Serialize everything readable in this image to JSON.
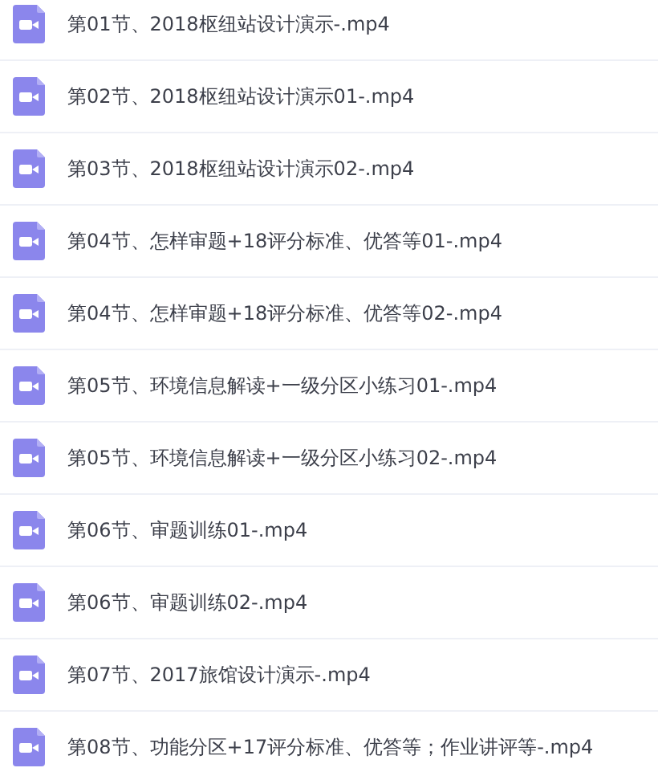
{
  "files": [
    {
      "name": "第01节、2018枢纽站设计演示-.mp4"
    },
    {
      "name": "第02节、2018枢纽站设计演示01-.mp4"
    },
    {
      "name": "第03节、2018枢纽站设计演示02-.mp4"
    },
    {
      "name": "第04节、怎样审题+18评分标准、优答等01-.mp4"
    },
    {
      "name": "第04节、怎样审题+18评分标准、优答等02-.mp4"
    },
    {
      "name": "第05节、环境信息解读+一级分区小练习01-.mp4"
    },
    {
      "name": "第05节、环境信息解读+一级分区小练习02-.mp4"
    },
    {
      "name": "第06节、审题训练01-.mp4"
    },
    {
      "name": "第06节、审题训练02-.mp4"
    },
    {
      "name": "第07节、2017旅馆设计演示-.mp4"
    },
    {
      "name": "第08节、功能分区+17评分标准、优答等；作业讲评等-.mp4"
    }
  ]
}
